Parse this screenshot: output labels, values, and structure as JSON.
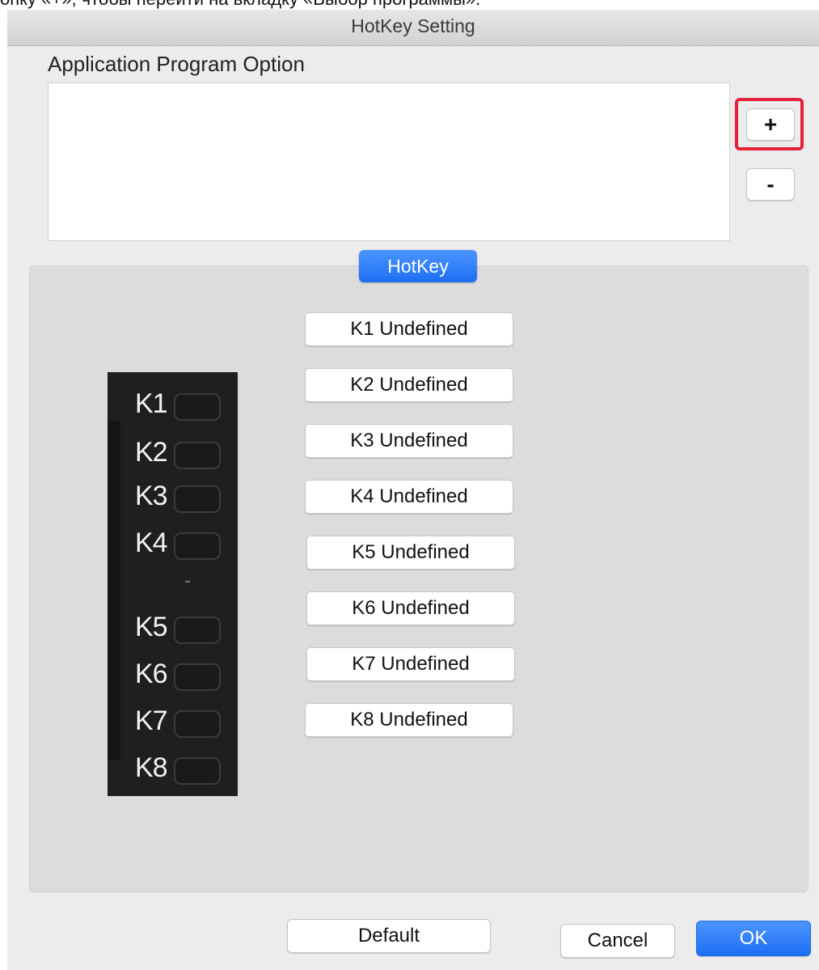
{
  "caption_text": "опку «+», чтобы перейти на вкладку «Выбор программы».",
  "window": {
    "title": "HotKey Setting"
  },
  "app_options": {
    "label": "Application Program Option",
    "add_label": "+",
    "remove_label": "-",
    "items": []
  },
  "tab": {
    "label": "HotKey"
  },
  "device_keys": [
    "K1",
    "K2",
    "K3",
    "K4",
    "K5",
    "K6",
    "K7",
    "K8"
  ],
  "hotkeys": [
    "K1 Undefined",
    "K2 Undefined",
    "K3 Undefined",
    "K4 Undefined",
    "K5 Undefined",
    "K6 Undefined",
    "K7 Undefined",
    "K8 Undefined"
  ],
  "footer": {
    "default_label": "Default",
    "cancel_label": "Cancel",
    "ok_label": "OK"
  },
  "colors": {
    "accent": "#1c6ef3",
    "highlight": "#e5203a",
    "panel": "#dcdcdc",
    "window_bg": "#ececec"
  }
}
